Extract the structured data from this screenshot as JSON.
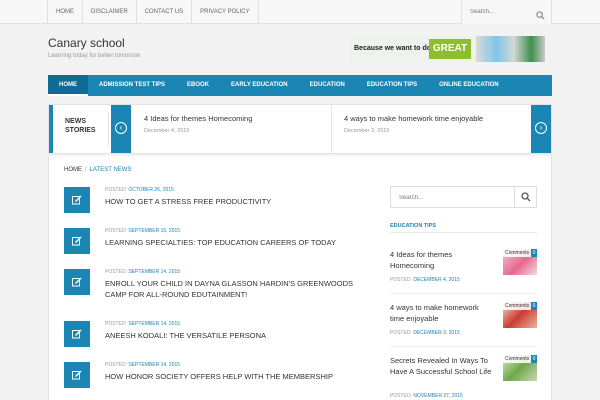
{
  "topnav": {
    "items": [
      "HOME",
      "DISCLAIMER",
      "CONTACT US",
      "PRIVACY POLICY"
    ],
    "search_placeholder": "Search..."
  },
  "header": {
    "site_title": "Canary school",
    "tagline": "Learning today for better tomorrow",
    "banner_text": "Because we want to do",
    "banner_highlight": "GREAT"
  },
  "mainnav": {
    "items": [
      "HOME",
      "ADMISSION TEST TIPS",
      "EBOOK",
      "EARLY EDUCATION",
      "EDUCATION",
      "EDUCATION TIPS",
      "ONLINE EDUCATION"
    ]
  },
  "ticker": {
    "label_line1": "NEWS",
    "label_line2": "STORIES",
    "items": [
      {
        "title": "4 Ideas for themes Homecoming",
        "date": "December 4, 2015"
      },
      {
        "title": "4 ways to make homework time enjoyable",
        "date": "December 3, 2015"
      }
    ]
  },
  "breadcrumb": {
    "home": "HOME",
    "separator": "/",
    "current": "LATEST NEWS"
  },
  "posts": [
    {
      "meta_label": "POSTED:",
      "date": "OCTOBER 26, 2015",
      "title": "HOW TO GET A STRESS FREE PRODUCTIVITY"
    },
    {
      "meta_label": "POSTED:",
      "date": "SEPTEMBER 15, 2015",
      "title": "LEARNING SPECIALTIES: TOP EDUCATION CAREERS OF TODAY"
    },
    {
      "meta_label": "POSTED:",
      "date": "SEPTEMBER 14, 2015",
      "title": "ENROLL YOUR CHILD IN DAYNA GLASSON HARDIN'S GREENWOODS CAMP FOR ALL-ROUND EDUTAINMENT!"
    },
    {
      "meta_label": "POSTED:",
      "date": "SEPTEMBER 14, 2015",
      "title": "ANEESH KODALI: THE VERSATILE PERSONA"
    },
    {
      "meta_label": "POSTED:",
      "date": "SEPTEMBER 14, 2015",
      "title": "HOW HONOR SOCIETY OFFERS HELP WITH THE MEMBERSHIP"
    }
  ],
  "sidebar": {
    "search_placeholder": "Search...",
    "widget_title": "EDUCATION TIPS",
    "items": [
      {
        "title": "4 Ideas for themes Homecoming",
        "meta_label": "POSTED:",
        "date": "DECEMBER 4, 2015",
        "thumb_label": "Comments",
        "count": "0"
      },
      {
        "title": "4 ways to make homework time enjoyable",
        "meta_label": "POSTED:",
        "date": "DECEMBER 3, 2015",
        "thumb_label": "Comments",
        "count": "0"
      },
      {
        "title": "Secrets Revealed In Ways To Have A Successful School Life",
        "meta_label": "POSTED:",
        "date": "NOVEMBER 27, 2015",
        "thumb_label": "Comments",
        "count": "0"
      }
    ]
  },
  "colors": {
    "accent": "#1b86b4",
    "accent_dark": "#0f6d95",
    "banner_green": "#8cbf2a"
  }
}
